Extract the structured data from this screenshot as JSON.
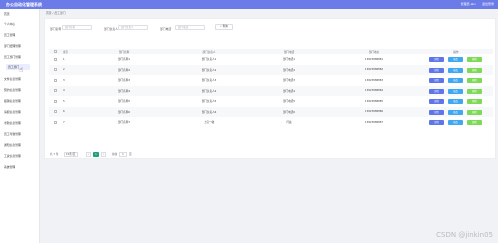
{
  "header": {
    "title": "办公自动化管理系统",
    "admin": "管理员 abc",
    "logout": "退出登录"
  },
  "sidebar": {
    "items": [
      {
        "label": "首页"
      },
      {
        "label": "个人中心"
      },
      {
        "label": "员工管理"
      },
      {
        "label": "部门经理管理"
      },
      {
        "label": "员工部门管理"
      },
      {
        "label": "员工部门",
        "active": true
      },
      {
        "label": "文件信息管理"
      },
      {
        "label": "预约信息管理"
      },
      {
        "label": "报销信息管理"
      },
      {
        "label": "请假信息管理"
      },
      {
        "label": "考勤信息管理"
      },
      {
        "label": "员工考勤管理"
      },
      {
        "label": "通知信息管理"
      },
      {
        "label": "工资信息管理"
      },
      {
        "label": "系统管理"
      }
    ]
  },
  "breadcrumb": {
    "home": "首页",
    "sep": "/",
    "current": "员工部门"
  },
  "filters": {
    "dept_name_label": "部门名称",
    "dept_name_placeholder": "部门名称",
    "dept_head_label": "部门负责人",
    "dept_head_placeholder": "部门负责人",
    "dept_phone_label": "部门电话",
    "dept_phone_placeholder": "部门电话",
    "search_label": "查询"
  },
  "table": {
    "headers": [
      "索引",
      "部门名称",
      "部门负责人",
      "部门电话",
      "部门地址",
      "操作"
    ],
    "rows": [
      {
        "index": "1",
        "name": "部门名称1",
        "head": "部门负责人1",
        "phone": "部门电话1",
        "addr": "13823888881"
      },
      {
        "index": "2",
        "name": "部门名称2",
        "head": "部门负责人2",
        "phone": "部门电话2",
        "addr": "13823888882"
      },
      {
        "index": "3",
        "name": "部门名称3",
        "head": "部门负责人3",
        "phone": "部门电话3",
        "addr": "13823888883"
      },
      {
        "index": "4",
        "name": "部门名称4",
        "head": "部门负责人4",
        "phone": "部门电话4",
        "addr": "13823888884"
      },
      {
        "index": "5",
        "name": "部门名称5",
        "head": "部门负责人5",
        "phone": "部门电话5",
        "addr": "13823888885"
      },
      {
        "index": "6",
        "name": "部门名称6",
        "head": "部门负责人6",
        "phone": "部门电话6",
        "addr": "13823888886"
      },
      {
        "index": "7",
        "name": "部门名称7",
        "head": "上官一敏",
        "phone": "行政",
        "addr": "13823888887"
      }
    ],
    "actions": {
      "view": "详情",
      "edit": "修改",
      "del": "删除"
    }
  },
  "pager": {
    "total": "共 7 条",
    "size": "10条/页",
    "prev": "‹",
    "page": "1",
    "next": "›",
    "goto": "前往",
    "goto_value": "1",
    "unit": "页"
  },
  "watermark": "CSDN @jinkin05"
}
